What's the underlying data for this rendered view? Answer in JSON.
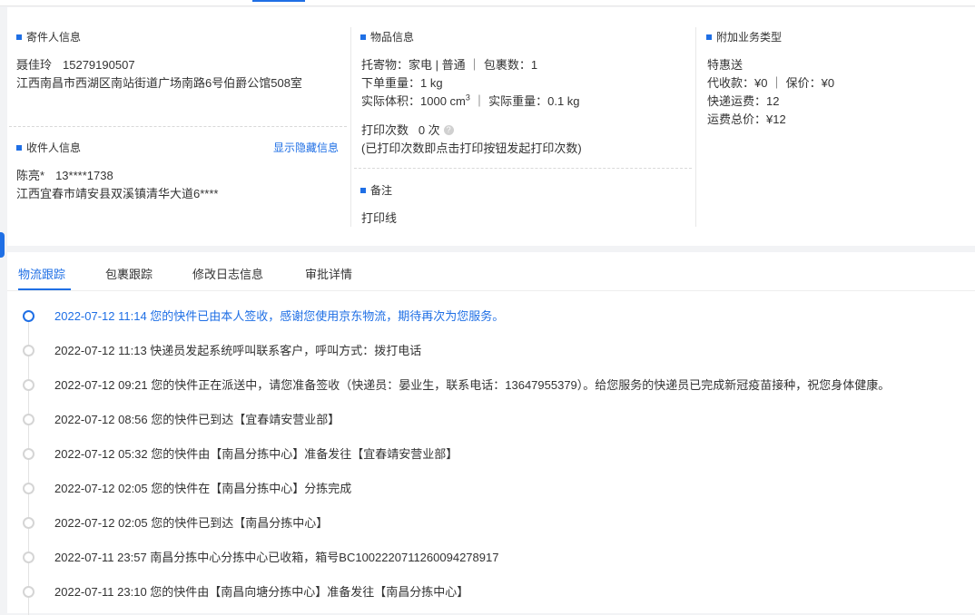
{
  "colors": {
    "accent": "#1f6fe5",
    "text": "#333333",
    "muted": "#d5d5d5"
  },
  "sender": {
    "title": "寄件人信息",
    "name": "聂佳玲",
    "phone": "15279190507",
    "address": "江西南昌市西湖区南站街道广场南路6号伯爵公馆508室"
  },
  "receiver": {
    "title": "收件人信息",
    "show_hidden_link": "显示隐藏信息",
    "name": "陈亮*",
    "phone": "13****1738",
    "address": "江西宜春市靖安县双溪镇清华大道6****"
  },
  "goods": {
    "title": "物品信息",
    "line1": "托寄物：家电 | 普通 ｜ 包裹数：1",
    "line2": "下单重量：1 kg",
    "line3_prefix": "实际体积：1000 cm",
    "line3_sup": "3",
    "line3_suffix": " ｜ 实际重量：0.1 kg",
    "print_count": "打印次数   0 次",
    "print_help_icon": "question-icon",
    "print_note": "(已打印次数即点击打印按钮发起打印次数)"
  },
  "remark": {
    "title": "备注",
    "value": "打印线"
  },
  "extra": {
    "title": "附加业务类型",
    "service": "特惠送",
    "cod": "代收款：¥0 ｜ 保价：¥0",
    "freight": "快递运费：12",
    "total": "运费总价：¥12"
  },
  "tabs": [
    {
      "label": "物流跟踪",
      "active": true
    },
    {
      "label": "包裹跟踪",
      "active": false
    },
    {
      "label": "修改日志信息",
      "active": false
    },
    {
      "label": "审批详情",
      "active": false
    }
  ],
  "events": [
    {
      "text": "2022-07-12 11:14 您的快件已由本人签收，感谢您使用京东物流，期待再次为您服务。",
      "active": true
    },
    {
      "text": "2022-07-12 11:13 快递员发起系统呼叫联系客户，呼叫方式：拨打电话",
      "active": false
    },
    {
      "text": "2022-07-12 09:21 您的快件正在派送中，请您准备签收（快递员：晏业生，联系电话：13647955379）。给您服务的快递员已完成新冠疫苗接种，祝您身体健康。",
      "active": false
    },
    {
      "text": "2022-07-12 08:56 您的快件已到达【宜春靖安营业部】",
      "active": false
    },
    {
      "text": "2022-07-12 05:32 您的快件由【南昌分拣中心】准备发往【宜春靖安营业部】",
      "active": false
    },
    {
      "text": "2022-07-12 02:05 您的快件在【南昌分拣中心】分拣完成",
      "active": false
    },
    {
      "text": "2022-07-12 02:05 您的快件已到达【南昌分拣中心】",
      "active": false
    },
    {
      "text": "2022-07-11 23:57 南昌分拣中心分拣中心已收箱，箱号BC1002220711260094278917",
      "active": false
    },
    {
      "text": "2022-07-11 23:10 您的快件由【南昌向塘分拣中心】准备发往【南昌分拣中心】",
      "active": false
    }
  ]
}
